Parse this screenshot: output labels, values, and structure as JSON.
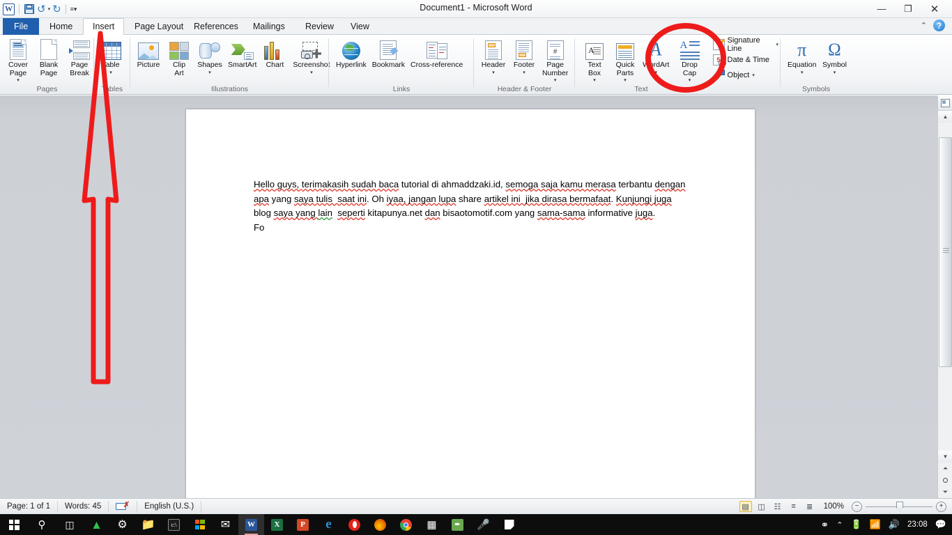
{
  "window": {
    "title": "Document1  -  Microsoft Word",
    "minimize": "—",
    "restore": "❐",
    "close": "✕",
    "ribbon_collapse": "⌃",
    "help": "?"
  },
  "qat": {
    "word_logo": "W",
    "save": "save-icon",
    "undo": "undo-icon",
    "undo_caret": "▾",
    "redo": "redo-icon",
    "customize": "☰"
  },
  "tabs": [
    {
      "label": "File",
      "state": "file"
    },
    {
      "label": "Home",
      "state": "normal"
    },
    {
      "label": "Insert",
      "state": "active"
    },
    {
      "label": "Page Layout",
      "state": "normal"
    },
    {
      "label": "References",
      "state": "normal"
    },
    {
      "label": "Mailings",
      "state": "normal"
    },
    {
      "label": "Review",
      "state": "normal"
    },
    {
      "label": "View",
      "state": "normal"
    }
  ],
  "ribbon": {
    "groups": [
      {
        "name": "Pages",
        "label": "Pages",
        "buttons": [
          {
            "label": "Cover\nPage",
            "dropdown": "▾",
            "icon": "cover-page-icon"
          },
          {
            "label": "Blank\nPage",
            "dropdown": "",
            "icon": "blank-page-icon"
          },
          {
            "label": "Page\nBreak",
            "dropdown": "",
            "icon": "page-break-icon"
          }
        ]
      },
      {
        "name": "Tables",
        "label": "Tables",
        "buttons": [
          {
            "label": "Table",
            "dropdown": "▾",
            "icon": "table-icon"
          }
        ]
      },
      {
        "name": "Illustrations",
        "label": "Illustrations",
        "buttons": [
          {
            "label": "Picture",
            "dropdown": "",
            "icon": "picture-icon"
          },
          {
            "label": "Clip\nArt",
            "dropdown": "",
            "icon": "clip-art-icon"
          },
          {
            "label": "Shapes",
            "dropdown": "▾",
            "icon": "shapes-icon"
          },
          {
            "label": "SmartArt",
            "dropdown": "",
            "icon": "smartart-icon"
          },
          {
            "label": "Chart",
            "dropdown": "",
            "icon": "chart-icon"
          },
          {
            "label": "Screenshot",
            "dropdown": "▾",
            "icon": "screenshot-icon"
          }
        ]
      },
      {
        "name": "Links",
        "label": "Links",
        "buttons": [
          {
            "label": "Hyperlink",
            "dropdown": "",
            "icon": "hyperlink-icon"
          },
          {
            "label": "Bookmark",
            "dropdown": "",
            "icon": "bookmark-icon"
          },
          {
            "label": "Cross-reference",
            "dropdown": "",
            "icon": "cross-reference-icon"
          }
        ]
      },
      {
        "name": "Header & Footer",
        "label": "Header & Footer",
        "buttons": [
          {
            "label": "Header",
            "dropdown": "▾",
            "icon": "header-icon"
          },
          {
            "label": "Footer",
            "dropdown": "▾",
            "icon": "footer-icon"
          },
          {
            "label": "Page\nNumber",
            "dropdown": "▾",
            "icon": "page-number-icon"
          }
        ]
      },
      {
        "name": "Text",
        "label": "Text",
        "buttons": [
          {
            "label": "Text\nBox",
            "dropdown": "▾",
            "icon": "text-box-icon"
          },
          {
            "label": "Quick\nParts",
            "dropdown": "▾",
            "icon": "quick-parts-icon"
          },
          {
            "label": "WordArt",
            "dropdown": "▾",
            "icon": "wordart-icon"
          },
          {
            "label": "Drop\nCap",
            "dropdown": "▾",
            "icon": "drop-cap-icon"
          }
        ],
        "small_buttons": [
          {
            "label": "Signature Line",
            "dropdown": "▾",
            "icon": "signature-line-icon"
          },
          {
            "label": "Date & Time",
            "dropdown": "",
            "icon": "date-time-icon"
          },
          {
            "label": "Object",
            "dropdown": "▾",
            "icon": "object-icon"
          }
        ]
      },
      {
        "name": "Symbols",
        "label": "Symbols",
        "buttons": [
          {
            "label": "Equation",
            "dropdown": "▾",
            "icon": "equation-pi-icon",
            "glyph": "π"
          },
          {
            "label": "Symbol",
            "dropdown": "▾",
            "icon": "symbol-omega-icon",
            "glyph": "Ω"
          }
        ]
      }
    ]
  },
  "document": {
    "paragraph_runs": [
      {
        "text": "Hello guys, ",
        "spell": "none"
      },
      {
        "text": "terimakasih sudah baca",
        "spell": "red"
      },
      {
        "text": " tutorial di ahmaddzaki.id, ",
        "spell": "none"
      },
      {
        "text": "semoga saja kamu merasa",
        "spell": "red"
      },
      {
        "text": " terbantu ",
        "spell": "none"
      },
      {
        "text": "dengan apa",
        "spell": "red"
      },
      {
        "text": " yang ",
        "spell": "none"
      },
      {
        "text": "saya tulis  saat ini",
        "spell": "red"
      },
      {
        "text": ". Oh ",
        "spell": "none"
      },
      {
        "text": "iyaa, jangan lupa",
        "spell": "red"
      },
      {
        "text": " share ",
        "spell": "none"
      },
      {
        "text": "artikel ini  jika dirasa bermafaat",
        "spell": "red"
      },
      {
        "text": ". ",
        "spell": "none"
      },
      {
        "text": "Kunjungi juga",
        "spell": "red"
      },
      {
        "text": " blog ",
        "spell": "none"
      },
      {
        "text": "saya yang ",
        "spell": "red"
      },
      {
        "text": "lain",
        "spell": "green"
      },
      {
        "text": "  ",
        "spell": "none"
      },
      {
        "text": "seperti",
        "spell": "red"
      },
      {
        "text": " kitapunya.net ",
        "spell": "none"
      },
      {
        "text": "dan",
        "spell": "red"
      },
      {
        "text": " bisaotomotif.com yang ",
        "spell": "none"
      },
      {
        "text": "sama-sama",
        "spell": "red"
      },
      {
        "text": " informative ",
        "spell": "none"
      },
      {
        "text": "juga",
        "spell": "red"
      },
      {
        "text": ".",
        "spell": "none"
      }
    ],
    "last_line": "Fo"
  },
  "annotations": {
    "arrow_target": "Insert",
    "circle_target": "Drop Cap",
    "color": "#ee1b1b"
  },
  "statusbar": {
    "page": "Page: 1 of 1",
    "words": "Words: 45",
    "proofing": "proofing-errors-icon",
    "language": "English (U.S.)",
    "views": [
      {
        "name": "print-layout-view",
        "glyph": "▤",
        "selected": true
      },
      {
        "name": "full-screen-reading-view",
        "glyph": "◫",
        "selected": false
      },
      {
        "name": "web-layout-view",
        "glyph": "☷",
        "selected": false
      },
      {
        "name": "outline-view",
        "glyph": "≡",
        "selected": false
      },
      {
        "name": "draft-view",
        "glyph": "≣",
        "selected": false
      }
    ],
    "zoom": "100%",
    "zoom_out": "−",
    "zoom_in": "+"
  },
  "scrollbar": {
    "view_ruler": "view-ruler-icon",
    "up": "▲",
    "down": "▼",
    "previous": "⤒",
    "select_object": "select-browse-object-icon",
    "next": "⤓"
  },
  "taskbar": {
    "start": "start-button",
    "search": "⌕",
    "task_view": "task-view-button",
    "apps": [
      {
        "name": "adobe-reader",
        "glyph": "A",
        "bg": "#0f0f0f",
        "fg": "#35c04a"
      },
      {
        "name": "settings",
        "glyph": "⚙",
        "bg": "#0f0f0f",
        "fg": "#ffffff"
      },
      {
        "name": "file-explorer",
        "glyph": "▰",
        "bg": "#0f0f0f",
        "fg": "#f5bd4a"
      },
      {
        "name": "command-prompt",
        "glyph": "c:\\",
        "bg": "#1c1c1c",
        "fg": "#dddddd"
      },
      {
        "name": "microsoft-store",
        "glyph": "⊞",
        "bg": "#0f0f0f",
        "fg": "#ffffff"
      },
      {
        "name": "mail",
        "glyph": "✉",
        "bg": "#0f0f0f",
        "fg": "#ffffff"
      },
      {
        "name": "word",
        "glyph": "W",
        "bg": "#2b579a",
        "fg": "#ffffff",
        "state": "active"
      },
      {
        "name": "excel",
        "glyph": "X",
        "bg": "#1d6f42",
        "fg": "#ffffff"
      },
      {
        "name": "powerpoint",
        "glyph": "P",
        "bg": "#d24726",
        "fg": "#ffffff"
      },
      {
        "name": "microsoft-edge",
        "glyph": "e",
        "bg": "#0f0f0f",
        "fg": "#2c8fd6"
      },
      {
        "name": "opera",
        "glyph": "O",
        "bg": "#e2231a",
        "fg": "#ffffff"
      },
      {
        "name": "firefox",
        "glyph": "●",
        "bg": "#e66000",
        "fg": "#ffcb00"
      },
      {
        "name": "google-chrome",
        "glyph": "●",
        "bg": "#4285f4",
        "fg": "#ffffff"
      },
      {
        "name": "calculator",
        "glyph": "⌸",
        "bg": "#0f0f0f",
        "fg": "#ffffff"
      },
      {
        "name": "green-app",
        "glyph": "✒",
        "bg": "#6aa84f",
        "fg": "#ffffff"
      },
      {
        "name": "voice-recorder",
        "glyph": "⚘",
        "bg": "#0f0f0f",
        "fg": "#dddddd"
      },
      {
        "name": "sticky-notes",
        "glyph": "◰",
        "bg": "#0f0f0f",
        "fg": "#ffffff"
      }
    ],
    "tray": {
      "people": "⚹",
      "show_hidden": "⌃",
      "battery": "battery-icon",
      "network": "wifi-icon",
      "volume": "◂",
      "clock": "23:08",
      "action_center": "▤"
    }
  }
}
